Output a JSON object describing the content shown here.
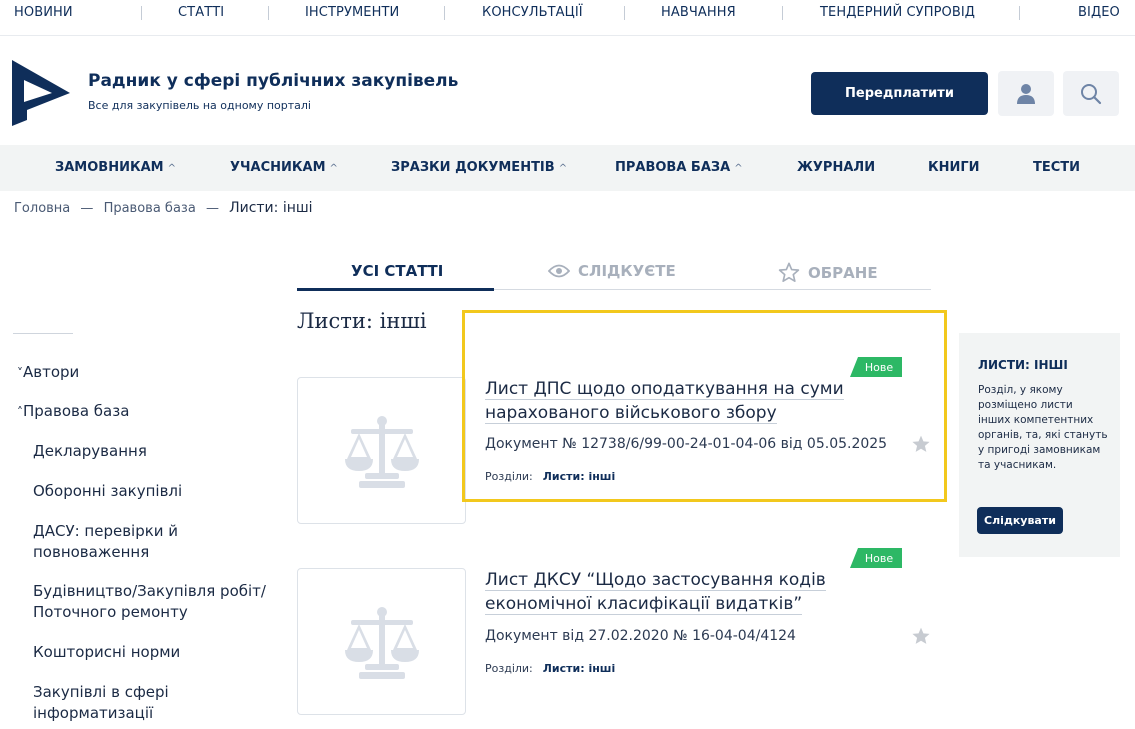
{
  "top_nav": [
    "НОВИНИ",
    "СТАТТІ",
    "ІНСТРУМЕНТИ",
    "КОНСУЛЬТАЦІЇ",
    "НАВЧАННЯ",
    "ТЕНДЕРНИЙ СУПРОВІД",
    "ВІДЕО"
  ],
  "header": {
    "title": "Радник у сфері публічних закупівель",
    "subtitle": "Все для закупівель на одному порталі",
    "subscribe_label": "Передплатити",
    "icons": [
      "user-icon",
      "search-icon"
    ]
  },
  "main_nav": [
    {
      "label": "ЗАМОВНИКАМ",
      "chevron": "^"
    },
    {
      "label": "УЧАСНИКАМ",
      "chevron": "^"
    },
    {
      "label": "ЗРАЗКИ ДОКУМЕНТІВ",
      "chevron": "^"
    },
    {
      "label": "ПРАВОВА БАЗА",
      "chevron": "^"
    },
    {
      "label": "ЖУРНАЛИ",
      "chevron": ""
    },
    {
      "label": "КНИГИ",
      "chevron": ""
    },
    {
      "label": "ТЕСТИ",
      "chevron": ""
    }
  ],
  "breadcrumb": {
    "items": [
      "Головна",
      "Правова база"
    ],
    "separator": "—",
    "current": "Листи: інші"
  },
  "tabs": [
    {
      "label": "УСІ СТАТТІ",
      "active": true,
      "icon": ""
    },
    {
      "label": "СЛІДКУЄТЕ",
      "active": false,
      "icon": "eye-icon"
    },
    {
      "label": "ОБРАНЕ",
      "active": false,
      "icon": "star-outline-icon"
    }
  ],
  "page_title": "Листи: інші",
  "sidebar": {
    "groups": [
      {
        "chevron": "˅",
        "label": "Автори"
      },
      {
        "chevron": "˄",
        "label": "Правова база"
      }
    ],
    "items": [
      "Декларування",
      "Оборонні закупівлі",
      "ДАСУ: перевірки й повноваження",
      "Будівництво/Закупівля робіт/ Поточного ремонту",
      "Кошторисні норми",
      "Закупівлі в сфері інформатизації"
    ]
  },
  "articles": [
    {
      "badge": "Нове",
      "title": "Лист ДПС щодо оподаткування на суми нарахованого військового збору",
      "meta": "Документ № 12738/6/99-00-24-01-04-06 від 05.05.2025",
      "sections_label": "Розділи:",
      "sections_value": "Листи: інші"
    },
    {
      "badge": "Нове",
      "title": "Лист ДКСУ “Щодо застосування кодів економічної класифікації видатків”",
      "meta": "Документ від 27.02.2020 № 16-04-04/4124",
      "sections_label": "Розділи:",
      "sections_value": "Листи: інші"
    }
  ],
  "info_box": {
    "title": "ЛИСТИ: ІНШІ",
    "text": "Розділ, у якому розміщено листи інших компетентних органів, та, які стануть у пригоді замовникам та учасникам.",
    "button_label": "Слідкувати"
  },
  "colors": {
    "primary": "#0f2e5a",
    "badge_green": "#2db865",
    "highlight": "#f2c81d",
    "nav_bg": "#f2f4f4"
  }
}
